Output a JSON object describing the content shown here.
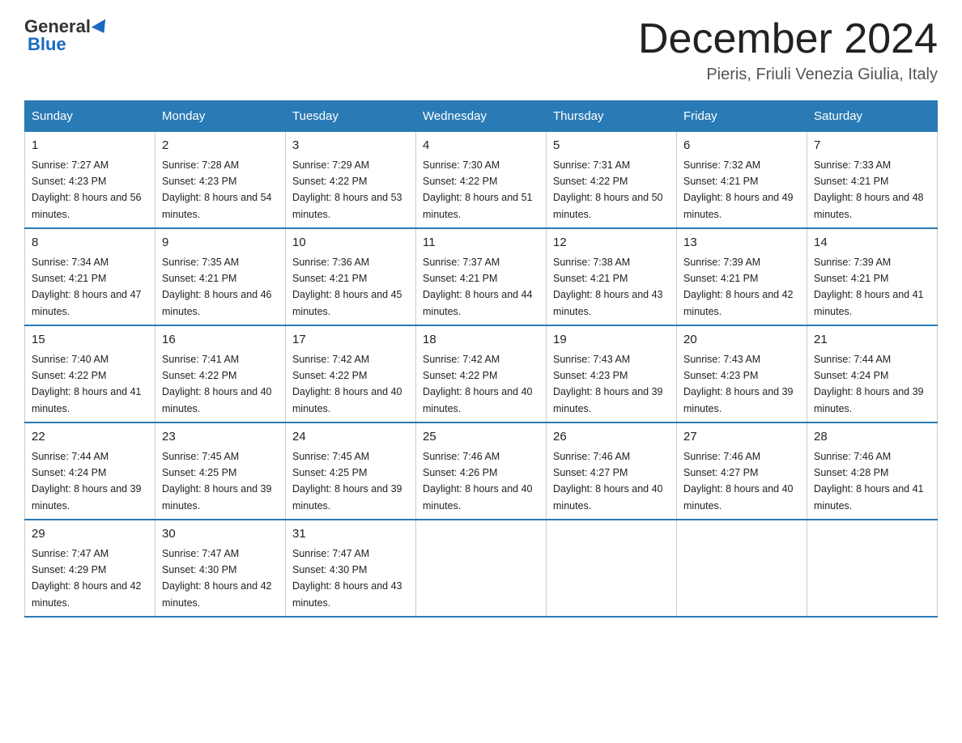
{
  "header": {
    "logo_general": "General",
    "logo_blue": "Blue",
    "month_title": "December 2024",
    "location": "Pieris, Friuli Venezia Giulia, Italy"
  },
  "days_of_week": [
    "Sunday",
    "Monday",
    "Tuesday",
    "Wednesday",
    "Thursday",
    "Friday",
    "Saturday"
  ],
  "weeks": [
    [
      {
        "day": "1",
        "sunrise": "7:27 AM",
        "sunset": "4:23 PM",
        "daylight": "8 hours and 56 minutes."
      },
      {
        "day": "2",
        "sunrise": "7:28 AM",
        "sunset": "4:23 PM",
        "daylight": "8 hours and 54 minutes."
      },
      {
        "day": "3",
        "sunrise": "7:29 AM",
        "sunset": "4:22 PM",
        "daylight": "8 hours and 53 minutes."
      },
      {
        "day": "4",
        "sunrise": "7:30 AM",
        "sunset": "4:22 PM",
        "daylight": "8 hours and 51 minutes."
      },
      {
        "day": "5",
        "sunrise": "7:31 AM",
        "sunset": "4:22 PM",
        "daylight": "8 hours and 50 minutes."
      },
      {
        "day": "6",
        "sunrise": "7:32 AM",
        "sunset": "4:21 PM",
        "daylight": "8 hours and 49 minutes."
      },
      {
        "day": "7",
        "sunrise": "7:33 AM",
        "sunset": "4:21 PM",
        "daylight": "8 hours and 48 minutes."
      }
    ],
    [
      {
        "day": "8",
        "sunrise": "7:34 AM",
        "sunset": "4:21 PM",
        "daylight": "8 hours and 47 minutes."
      },
      {
        "day": "9",
        "sunrise": "7:35 AM",
        "sunset": "4:21 PM",
        "daylight": "8 hours and 46 minutes."
      },
      {
        "day": "10",
        "sunrise": "7:36 AM",
        "sunset": "4:21 PM",
        "daylight": "8 hours and 45 minutes."
      },
      {
        "day": "11",
        "sunrise": "7:37 AM",
        "sunset": "4:21 PM",
        "daylight": "8 hours and 44 minutes."
      },
      {
        "day": "12",
        "sunrise": "7:38 AM",
        "sunset": "4:21 PM",
        "daylight": "8 hours and 43 minutes."
      },
      {
        "day": "13",
        "sunrise": "7:39 AM",
        "sunset": "4:21 PM",
        "daylight": "8 hours and 42 minutes."
      },
      {
        "day": "14",
        "sunrise": "7:39 AM",
        "sunset": "4:21 PM",
        "daylight": "8 hours and 41 minutes."
      }
    ],
    [
      {
        "day": "15",
        "sunrise": "7:40 AM",
        "sunset": "4:22 PM",
        "daylight": "8 hours and 41 minutes."
      },
      {
        "day": "16",
        "sunrise": "7:41 AM",
        "sunset": "4:22 PM",
        "daylight": "8 hours and 40 minutes."
      },
      {
        "day": "17",
        "sunrise": "7:42 AM",
        "sunset": "4:22 PM",
        "daylight": "8 hours and 40 minutes."
      },
      {
        "day": "18",
        "sunrise": "7:42 AM",
        "sunset": "4:22 PM",
        "daylight": "8 hours and 40 minutes."
      },
      {
        "day": "19",
        "sunrise": "7:43 AM",
        "sunset": "4:23 PM",
        "daylight": "8 hours and 39 minutes."
      },
      {
        "day": "20",
        "sunrise": "7:43 AM",
        "sunset": "4:23 PM",
        "daylight": "8 hours and 39 minutes."
      },
      {
        "day": "21",
        "sunrise": "7:44 AM",
        "sunset": "4:24 PM",
        "daylight": "8 hours and 39 minutes."
      }
    ],
    [
      {
        "day": "22",
        "sunrise": "7:44 AM",
        "sunset": "4:24 PM",
        "daylight": "8 hours and 39 minutes."
      },
      {
        "day": "23",
        "sunrise": "7:45 AM",
        "sunset": "4:25 PM",
        "daylight": "8 hours and 39 minutes."
      },
      {
        "day": "24",
        "sunrise": "7:45 AM",
        "sunset": "4:25 PM",
        "daylight": "8 hours and 39 minutes."
      },
      {
        "day": "25",
        "sunrise": "7:46 AM",
        "sunset": "4:26 PM",
        "daylight": "8 hours and 40 minutes."
      },
      {
        "day": "26",
        "sunrise": "7:46 AM",
        "sunset": "4:27 PM",
        "daylight": "8 hours and 40 minutes."
      },
      {
        "day": "27",
        "sunrise": "7:46 AM",
        "sunset": "4:27 PM",
        "daylight": "8 hours and 40 minutes."
      },
      {
        "day": "28",
        "sunrise": "7:46 AM",
        "sunset": "4:28 PM",
        "daylight": "8 hours and 41 minutes."
      }
    ],
    [
      {
        "day": "29",
        "sunrise": "7:47 AM",
        "sunset": "4:29 PM",
        "daylight": "8 hours and 42 minutes."
      },
      {
        "day": "30",
        "sunrise": "7:47 AM",
        "sunset": "4:30 PM",
        "daylight": "8 hours and 42 minutes."
      },
      {
        "day": "31",
        "sunrise": "7:47 AM",
        "sunset": "4:30 PM",
        "daylight": "8 hours and 43 minutes."
      },
      null,
      null,
      null,
      null
    ]
  ],
  "labels": {
    "sunrise_prefix": "Sunrise: ",
    "sunset_prefix": "Sunset: ",
    "daylight_prefix": "Daylight: "
  }
}
